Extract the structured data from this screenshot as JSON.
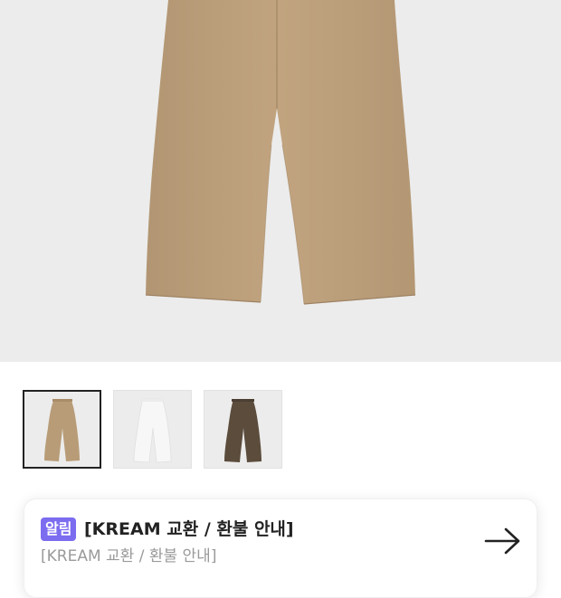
{
  "product": {
    "main_image": "beige-wide-pants-photo",
    "thumbnails": [
      {
        "name": "beige-pants-thumbnail",
        "color": "#b89c78",
        "selected": true
      },
      {
        "name": "white-pants-thumbnail",
        "color": "#f2f2f2",
        "selected": false
      },
      {
        "name": "brown-pants-thumbnail",
        "color": "#5b4c3c",
        "selected": false
      }
    ]
  },
  "notice": {
    "badge": "알림",
    "title": "[KREAM 교환 / 환불 안내]",
    "subtitle": "[KREAM 교환 / 환불 안내]",
    "arrow_icon": "arrow-right-icon",
    "badge_color": "#7b6cf0"
  }
}
